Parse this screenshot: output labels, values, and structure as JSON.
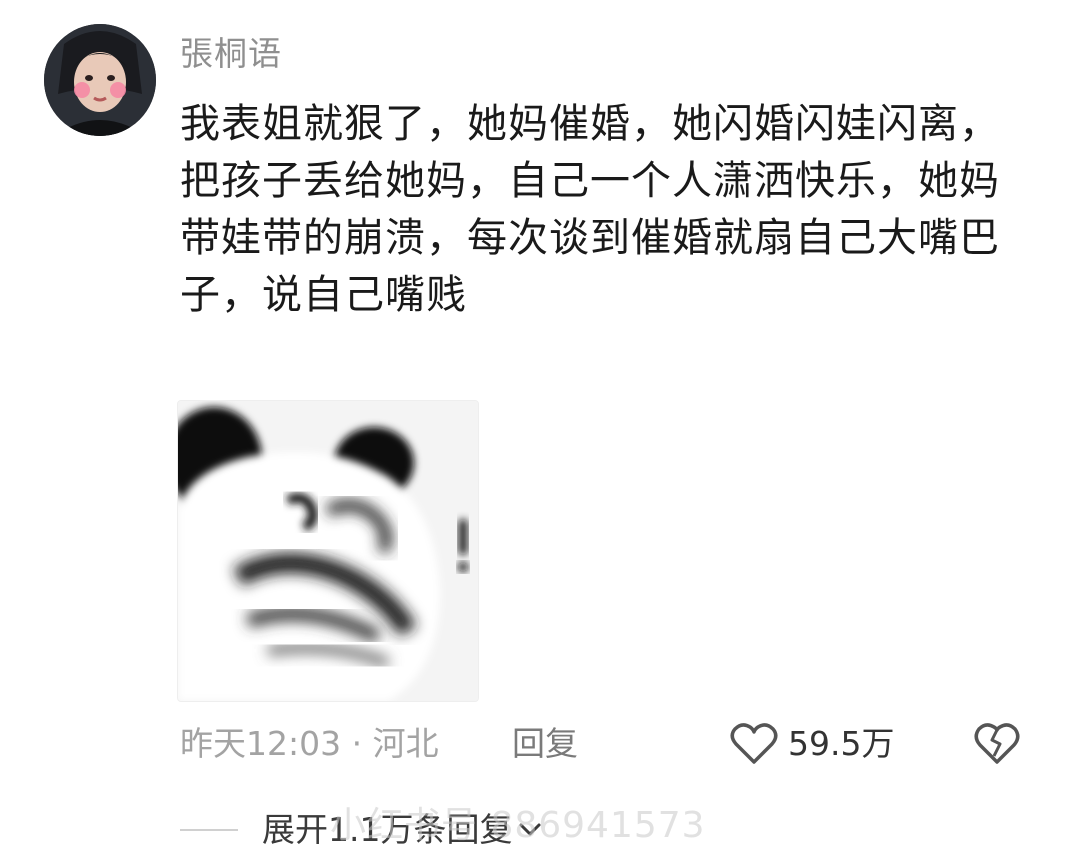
{
  "comment": {
    "username": "張桐语",
    "text": "我表姐就狠了，她妈催婚，她闪婚闪娃闪离，把孩子丢给她妈，自己一个人潇洒快乐，她妈带娃带的崩溃，每次谈到催婚就扇自己大嘴巴子，说自己嘴贱",
    "meta": "昨天12:03 · 河北",
    "reply_label": "回复",
    "like_count": "59.5万",
    "expand_label": "展开1.1万条回复",
    "watermark": "小红书号 886941573"
  },
  "colors": {
    "text": "#1a1a1a",
    "username": "#8f8f8f",
    "meta": "#a3a3a3",
    "like_icon": "#555555"
  },
  "icons": {
    "like": "heart-outline-icon",
    "dislike": "broken-heart-icon",
    "expand": "chevron-down-icon"
  }
}
